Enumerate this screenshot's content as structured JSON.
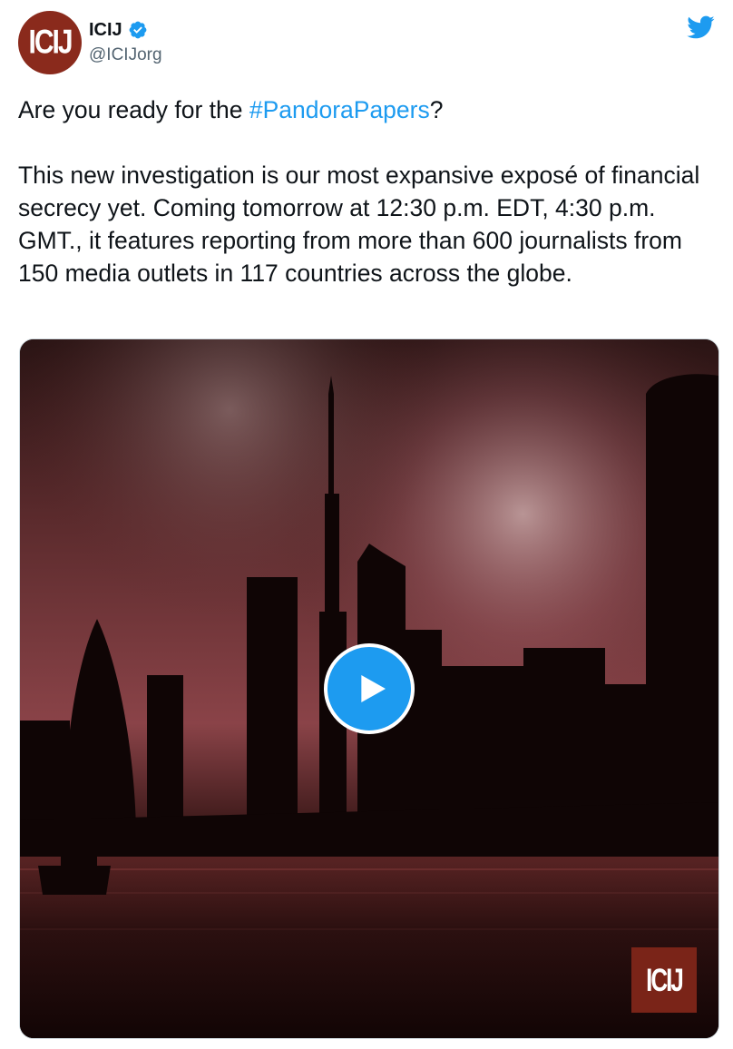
{
  "tweet": {
    "author": {
      "avatar_text": "ICIJ",
      "display_name": "ICIJ",
      "handle": "@ICIJorg",
      "verified": true
    },
    "text": {
      "line1_prefix": "Are you ready for the ",
      "hashtag": "#PandoraPapers",
      "line1_suffix": "?",
      "paragraph2": "This new investigation is our most expansive exposé of financial secrecy yet. Coming tomorrow at 12:30 p.m. EDT, 4:30 p.m. GMT., it features reporting from more than 600 journalists from 150 media outlets in 117 countries across the globe."
    },
    "media": {
      "type": "video",
      "watermark_text": "ICIJ",
      "play_icon": "play-icon"
    },
    "platform_icon": "twitter-bird-icon"
  },
  "colors": {
    "link": "#1d9bf0",
    "verified": "#1d9bf0",
    "brand_red": "#8a2a1c",
    "text": "#0f1419",
    "secondary_text": "#536471"
  }
}
